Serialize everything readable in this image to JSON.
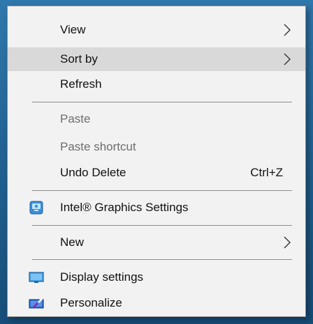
{
  "menu": {
    "items": [
      {
        "label": "View"
      },
      {
        "label": "Sort by"
      },
      {
        "label": "Refresh"
      },
      {
        "label": "Paste"
      },
      {
        "label": "Paste shortcut"
      },
      {
        "label": "Undo Delete",
        "shortcut": "Ctrl+Z"
      },
      {
        "label": "Intel® Graphics Settings",
        "icon": "intel-graphics-icon"
      },
      {
        "label": "New"
      },
      {
        "label": "Display settings",
        "icon": "display-settings-icon"
      },
      {
        "label": "Personalize",
        "icon": "personalize-icon"
      }
    ],
    "highlighted": "Sort by",
    "disabled": [
      "Paste",
      "Paste shortcut"
    ]
  },
  "colors": {
    "menu_background": "#f2f2f2",
    "highlight": "#d9d9d9",
    "disabled_text": "#6d6d6d",
    "desktop_background": "#1f5f8f"
  }
}
